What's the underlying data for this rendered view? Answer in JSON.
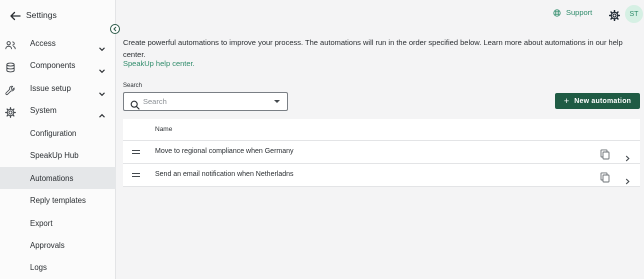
{
  "sidebar": {
    "title": "Settings",
    "items": [
      {
        "label": "Access",
        "icon": "users-icon"
      },
      {
        "label": "Components",
        "icon": "database-icon"
      },
      {
        "label": "Issue setup",
        "icon": "wrench-icon"
      },
      {
        "label": "System",
        "icon": "gear-icon"
      }
    ],
    "sub_items": [
      {
        "label": "Configuration"
      },
      {
        "label": "SpeakUp Hub"
      },
      {
        "label": "Automations",
        "active": true
      },
      {
        "label": "Reply templates"
      },
      {
        "label": "Export"
      },
      {
        "label": "Approvals"
      },
      {
        "label": "Logs"
      }
    ]
  },
  "header": {
    "support_label": "Support",
    "avatar_initials": "ST"
  },
  "main": {
    "intro": "Create powerful automations to improve your process. The automations will run in the order specified below. Learn more about automations in our help center.",
    "help_link": "SpeakUp help center.",
    "search_label": "Search",
    "search_placeholder": "Search",
    "new_button": "New automation",
    "table": {
      "column": "Name",
      "rows": [
        {
          "name": "Move to regional compliance when Germany"
        },
        {
          "name": "Send an email notification when Netherladns"
        }
      ]
    }
  },
  "colors": {
    "accent": "#2e8b6a",
    "primary_button": "#1f5b44",
    "active_item_bg": "#e5e7e9"
  }
}
